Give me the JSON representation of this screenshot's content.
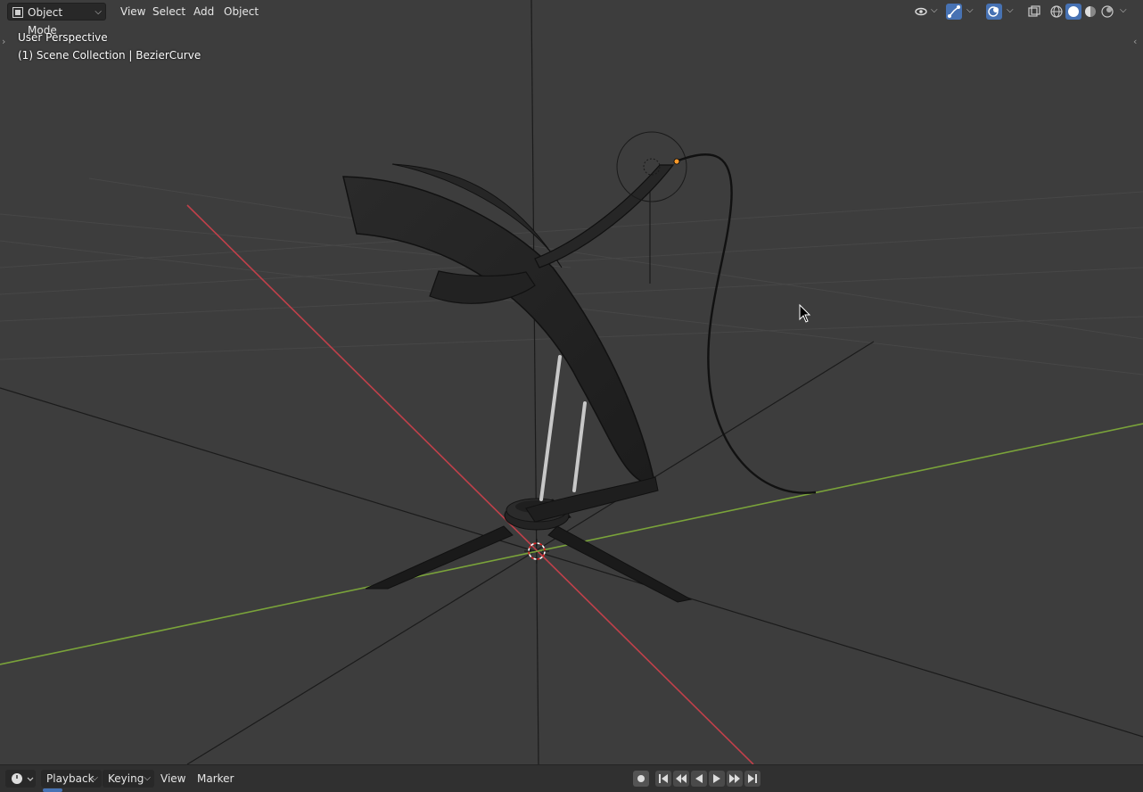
{
  "header": {
    "mode_label": "Object Mode",
    "menus": [
      "View",
      "Select",
      "Add",
      "Object"
    ]
  },
  "overlay": {
    "view_name": "User Perspective",
    "collection_info": "(1) Scene Collection | BezierCurve"
  },
  "header_icons": [
    "visibility-eye-icon",
    "gizmo-icon",
    "overlay-icon",
    "xray-icon",
    "wireframe-shading-icon",
    "solid-shading-icon",
    "material-shading-icon",
    "rendered-shading-icon"
  ],
  "timeline": {
    "menus": [
      "Playback",
      "Keying",
      "View",
      "Marker"
    ]
  },
  "colors": {
    "viewport_bg": "#3d3d3d",
    "x_axis": "#c0404a",
    "y_axis": "#7aa33a",
    "active_blue": "#4772b3",
    "selected_point": "#ff9b2b"
  }
}
